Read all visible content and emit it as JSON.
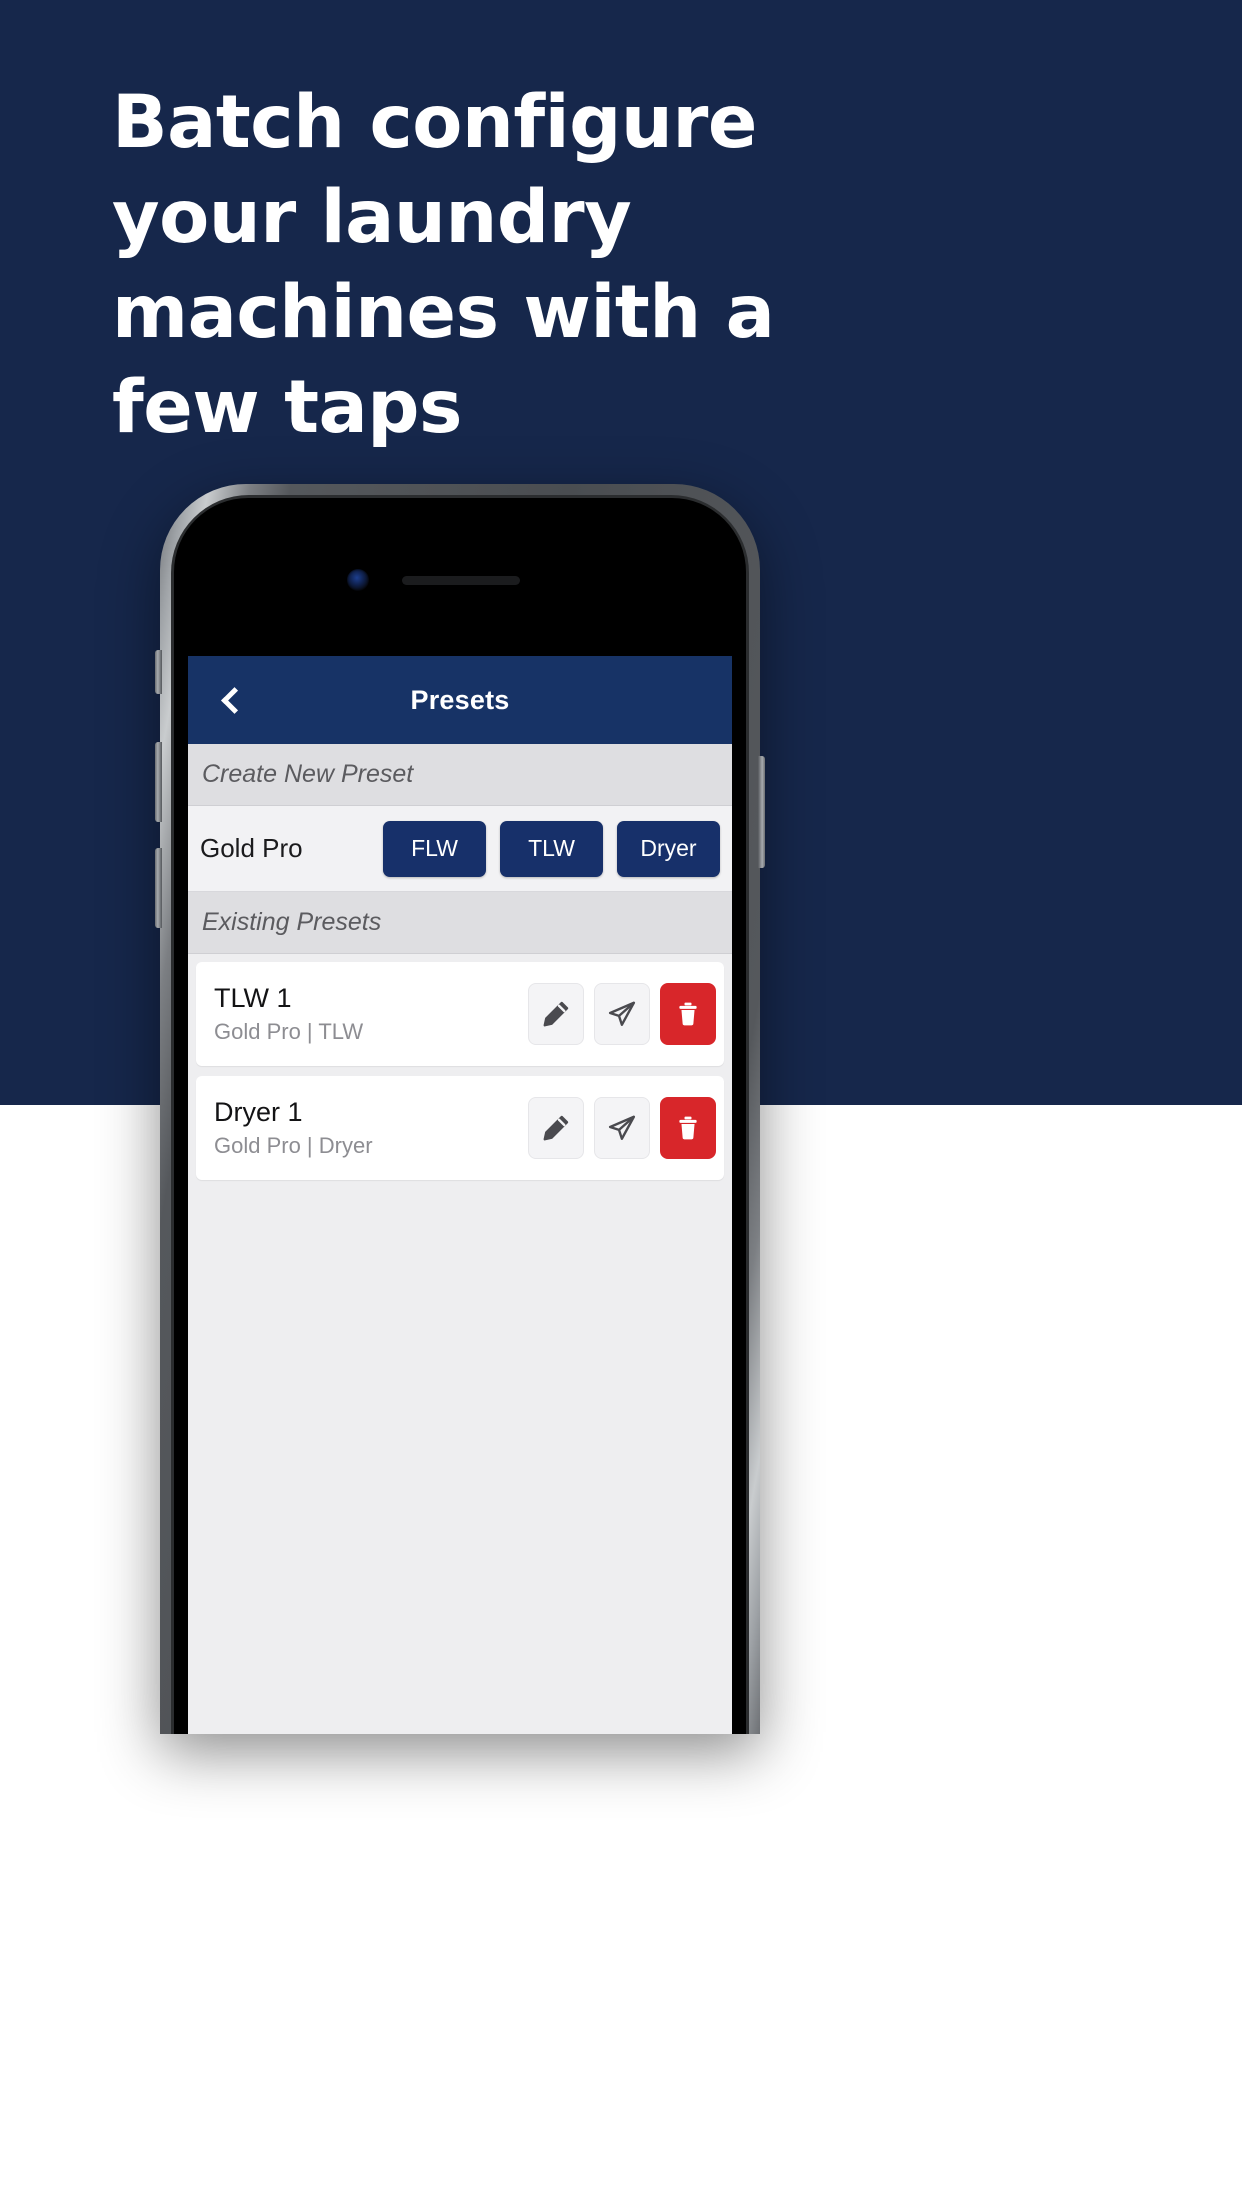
{
  "marketing": {
    "headline": "Batch configure\nyour laundry\nmachines with a\nfew taps",
    "bg_color": "#16274b",
    "headline_color": "#ffffff"
  },
  "app": {
    "navbar": {
      "title": "Presets",
      "back_icon": "chevron-left-icon",
      "bg_color": "#173366",
      "title_color": "#ffffff"
    },
    "sections": [
      {
        "header": "Create New Preset",
        "type": "create"
      },
      {
        "header": "Existing Presets",
        "type": "list"
      }
    ],
    "create_new": {
      "brand_label": "Gold Pro",
      "machine_type_buttons": [
        {
          "label": "FLW"
        },
        {
          "label": "TLW"
        },
        {
          "label": "Dryer"
        }
      ],
      "button_color": "#17306a",
      "button_text_color": "#ffffff"
    },
    "existing_presets": [
      {
        "title": "TLW 1",
        "subtitle": "Gold Pro | TLW",
        "actions": [
          {
            "name": "edit",
            "icon": "pencil-icon"
          },
          {
            "name": "send",
            "icon": "paper-plane-icon"
          },
          {
            "name": "delete",
            "icon": "trash-icon"
          }
        ]
      },
      {
        "title": "Dryer 1",
        "subtitle": "Gold Pro | Dryer",
        "actions": [
          {
            "name": "edit",
            "icon": "pencil-icon"
          },
          {
            "name": "send",
            "icon": "paper-plane-icon"
          },
          {
            "name": "delete",
            "icon": "trash-icon"
          }
        ]
      }
    ],
    "colors": {
      "delete_red": "#d8262a",
      "section_header_bg": "#dedee1",
      "list_bg": "#eeeef0",
      "row_bg": "#ffffff",
      "muted_text": "#8d8d92"
    }
  }
}
